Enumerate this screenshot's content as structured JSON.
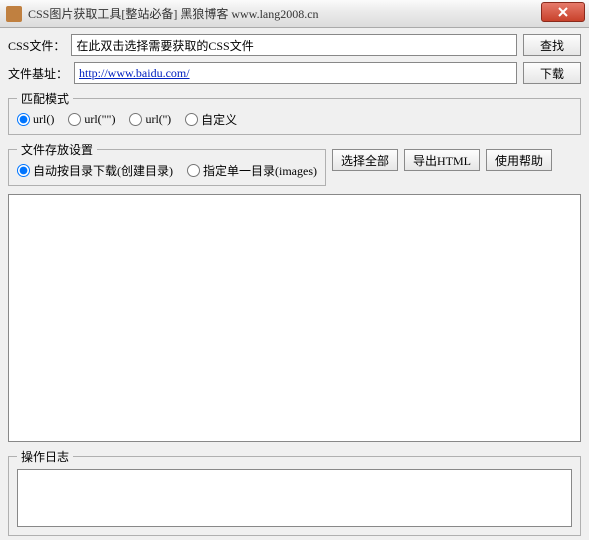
{
  "window": {
    "title": "CSS图片获取工具[整站必备] 黑狼博客 www.lang2008.cn"
  },
  "labels": {
    "css_file": "CSS文件：",
    "file_base": "文件基址："
  },
  "inputs": {
    "css_file_placeholder": "在此双击选择需要获取的CSS文件",
    "file_base_value": "http://www.baidu.com/"
  },
  "buttons": {
    "find": "查找",
    "download": "下载",
    "select_all": "选择全部",
    "export_html": "导出HTML",
    "help": "使用帮助"
  },
  "groups": {
    "match_mode": {
      "legend": "匹配模式",
      "options": {
        "url_plain": "url()",
        "url_dq": "url(\"\")",
        "url_sq": "url('')",
        "custom": "自定义"
      },
      "selected": "url_plain"
    },
    "save_settings": {
      "legend": "文件存放设置",
      "options": {
        "auto": "自动按目录下载(创建目录)",
        "single": "指定单一目录(images)"
      },
      "selected": "auto"
    },
    "log": {
      "legend": "操作日志"
    }
  }
}
